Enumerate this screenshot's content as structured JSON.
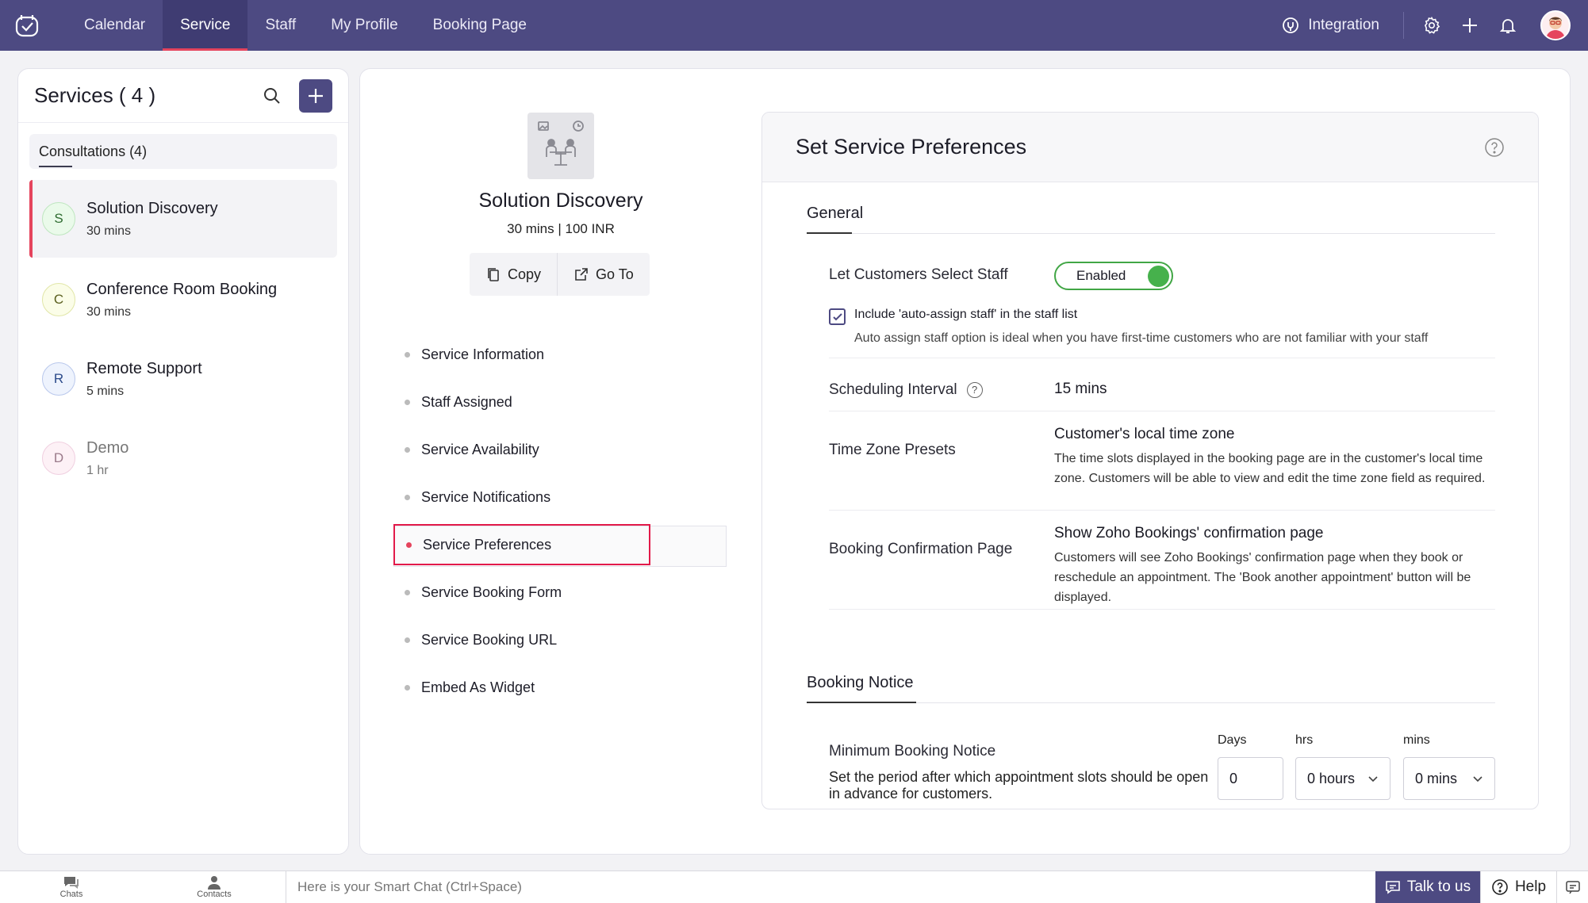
{
  "topbar": {
    "tabs": [
      {
        "label": "Calendar"
      },
      {
        "label": "Service"
      },
      {
        "label": "Staff"
      },
      {
        "label": "My Profile"
      },
      {
        "label": "Booking Page"
      }
    ],
    "integration_label": "Integration",
    "colors": {
      "bar": "#4d4a82",
      "active_underline": "#e5445d"
    }
  },
  "left_panel": {
    "title": "Services ( 4 )",
    "group_label": "Consultations (4)",
    "services": [
      {
        "initial": "S",
        "name": "Solution Discovery",
        "duration": "30 mins"
      },
      {
        "initial": "C",
        "name": "Conference Room Booking",
        "duration": "30 mins"
      },
      {
        "initial": "R",
        "name": "Remote Support",
        "duration": "5 mins"
      },
      {
        "initial": "D",
        "name": "Demo",
        "duration": "1 hr"
      }
    ]
  },
  "service_detail": {
    "name": "Solution Discovery",
    "meta": "30 mins | 100 INR",
    "copy_label": "Copy",
    "goto_label": "Go To",
    "menu": [
      {
        "label": "Service Information"
      },
      {
        "label": "Staff Assigned"
      },
      {
        "label": "Service Availability"
      },
      {
        "label": "Service Notifications"
      },
      {
        "label": "Service Preferences"
      },
      {
        "label": "Service Booking Form"
      },
      {
        "label": "Service Booking URL"
      },
      {
        "label": "Embed As Widget"
      }
    ]
  },
  "preferences": {
    "title": "Set Service Preferences",
    "general": {
      "section_title": "General",
      "select_staff_label": "Let Customers Select Staff",
      "select_staff_toggle": "Enabled",
      "auto_assign_label": "Include 'auto-assign staff' in the staff list",
      "auto_assign_desc": "Auto assign staff option is ideal when you have first-time customers who are not familiar with your staff",
      "scheduling_label": "Scheduling Interval",
      "scheduling_value": "15 mins",
      "timezone_label": "Time Zone Presets",
      "timezone_value": "Customer's local time zone",
      "timezone_desc": "The time slots displayed in the booking page are in the customer's local time zone. Customers will be able to view and edit the time zone field as required.",
      "confirm_label": "Booking Confirmation Page",
      "confirm_value": "Show Zoho Bookings' confirmation page",
      "confirm_desc": "Customers will see Zoho Bookings' confirmation page when they book or reschedule an appointment. The 'Book another appointment' button will be displayed."
    },
    "booking_notice": {
      "section_title": "Booking Notice",
      "min_label": "Minimum Booking Notice",
      "min_desc": "Set the period after which appointment slots should be open in advance for customers.",
      "days_label": "Days",
      "days_value": "0",
      "hrs_label": "hrs",
      "hrs_value": "0 hours",
      "mins_label": "mins",
      "mins_value": "0 mins"
    },
    "toggle_color": "#46b14c"
  },
  "bottombar": {
    "chats_label": "Chats",
    "contacts_label": "Contacts",
    "smart_chat_placeholder": "Here is your Smart Chat (Ctrl+Space)",
    "talk_label": "Talk to us",
    "help_label": "Help"
  }
}
